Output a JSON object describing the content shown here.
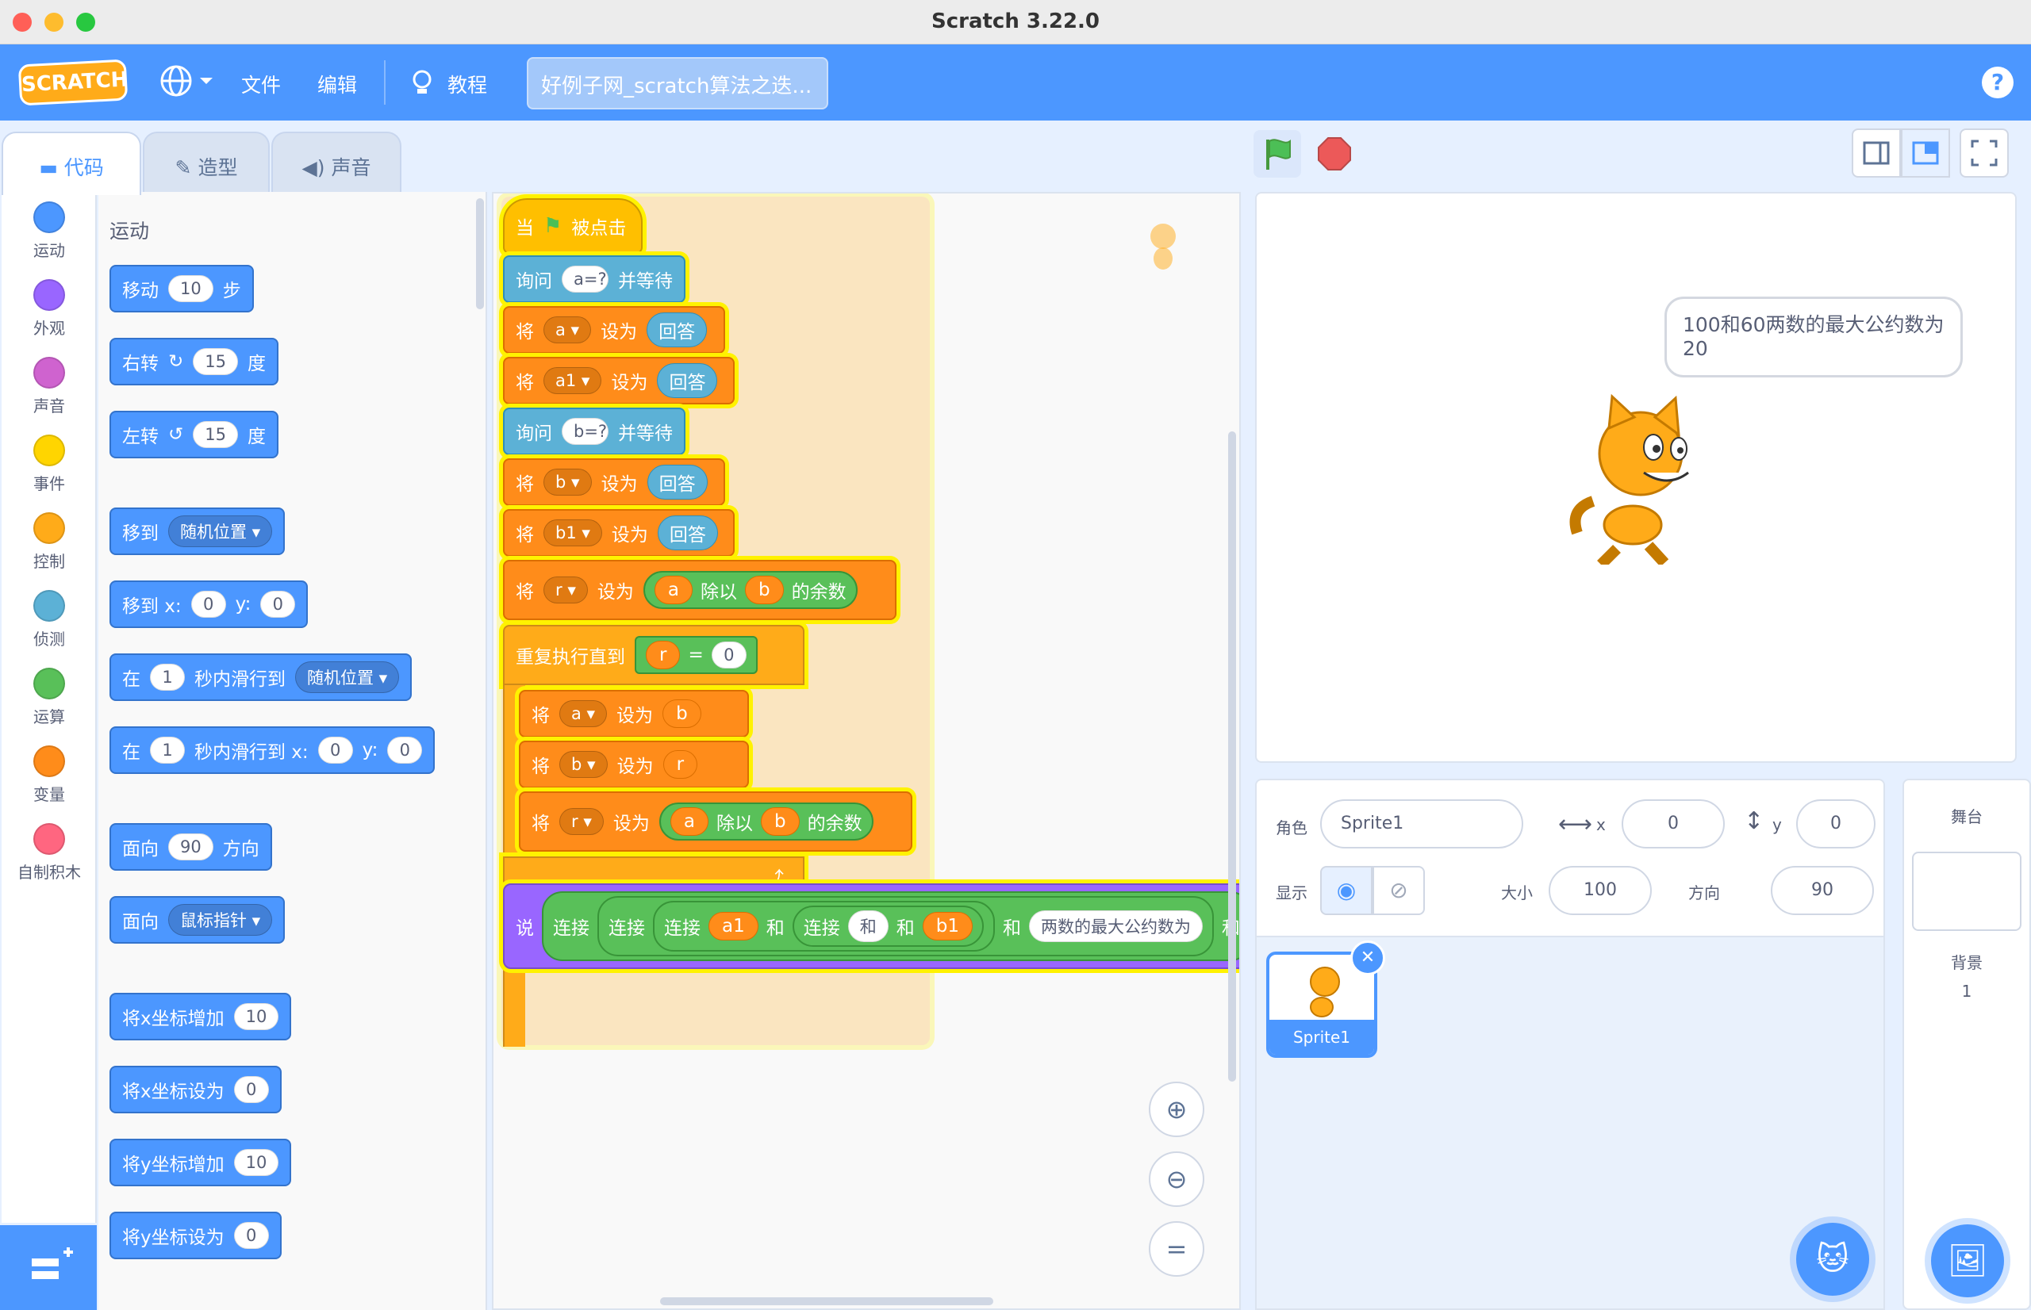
{
  "window": {
    "title": "Scratch 3.22.0"
  },
  "menu": {
    "logo": "SCRATCH",
    "file": "文件",
    "edit": "编辑",
    "tutorials": "教程",
    "project_title": "好例子网_scratch算法之迭...",
    "help": "?"
  },
  "tabs": {
    "code": "代码",
    "costumes": "造型",
    "sounds": "声音"
  },
  "categories": [
    {
      "label": "运动",
      "color": "#4c97ff"
    },
    {
      "label": "外观",
      "color": "#9966ff"
    },
    {
      "label": "声音",
      "color": "#cf63cf"
    },
    {
      "label": "事件",
      "color": "#ffd500"
    },
    {
      "label": "控制",
      "color": "#ffab19"
    },
    {
      "label": "侦测",
      "color": "#5cb1d6"
    },
    {
      "label": "运算",
      "color": "#59c059"
    },
    {
      "label": "变量",
      "color": "#ff8c1a"
    },
    {
      "label": "自制积木",
      "color": "#ff6680"
    }
  ],
  "palette": {
    "heading": "运动",
    "move": {
      "a": "移动",
      "n": "10",
      "b": "步"
    },
    "turn_right": {
      "a": "右转",
      "n": "15",
      "b": "度"
    },
    "turn_left": {
      "a": "左转",
      "n": "15",
      "b": "度"
    },
    "goto": {
      "a": "移到",
      "dd": "随机位置"
    },
    "goto_xy": {
      "a": "移到 x:",
      "x": "0",
      "b": "y:",
      "y": "0"
    },
    "glide": {
      "a": "在",
      "n": "1",
      "b": "秒内滑行到",
      "dd": "随机位置"
    },
    "glide_xy": {
      "a": "在",
      "n": "1",
      "b": "秒内滑行到 x:",
      "x": "0",
      "c": "y:",
      "y": "0"
    },
    "point_dir": {
      "a": "面向",
      "n": "90",
      "b": "方向"
    },
    "point_to": {
      "a": "面向",
      "dd": "鼠标指针"
    },
    "change_x": {
      "a": "将x坐标增加",
      "n": "10"
    },
    "set_x": {
      "a": "将x坐标设为",
      "n": "0"
    },
    "change_y": {
      "a": "将y坐标增加",
      "n": "10"
    },
    "set_y": {
      "a": "将y坐标设为",
      "n": "0"
    }
  },
  "script": {
    "hat": {
      "a": "当",
      "b": "被点击"
    },
    "ask1": {
      "a": "询问",
      "q": "a=?",
      "b": "并等待"
    },
    "set_a": {
      "k": "将",
      "v": "a",
      "s": "设为",
      "r": "回答"
    },
    "set_a1": {
      "k": "将",
      "v": "a1",
      "s": "设为",
      "r": "回答"
    },
    "ask2": {
      "a": "询问",
      "q": "b=?",
      "b": "并等待"
    },
    "set_b": {
      "k": "将",
      "v": "b",
      "s": "设为",
      "r": "回答"
    },
    "set_b1": {
      "k": "将",
      "v": "b1",
      "s": "设为",
      "r": "回答"
    },
    "set_r": {
      "k": "将",
      "v": "r",
      "s": "设为",
      "x": "a",
      "mod": "除以",
      "y": "b",
      "rem": "的余数"
    },
    "repeat": {
      "a": "重复执行直到",
      "l": "r",
      "eq": "=",
      "n": "0"
    },
    "in_a": {
      "k": "将",
      "v": "a",
      "s": "设为",
      "r": "b"
    },
    "in_b": {
      "k": "将",
      "v": "b",
      "s": "设为",
      "r": "r"
    },
    "in_r": {
      "k": "将",
      "v": "r",
      "s": "设为",
      "x": "a",
      "mod": "除以",
      "y": "b",
      "rem": "的余数"
    },
    "say": {
      "a": "说",
      "j1": "连接",
      "j2": "连接",
      "j3": "连接",
      "a1": "a1",
      "and1": "和",
      "j4": "连接",
      "and2": "和",
      "and3": "和",
      "b1": "b1",
      "and4": "和",
      "txt": "两数的最大公约数为",
      "tail": "和"
    }
  },
  "stage": {
    "bubble": "100和60两数的最大公约数为20"
  },
  "sprite_info": {
    "sprite_label": "角色",
    "name": "Sprite1",
    "x_label": "x",
    "x": "0",
    "y_label": "y",
    "y": "0",
    "show_label": "显示",
    "size_label": "大小",
    "size": "100",
    "dir_label": "方向",
    "dir": "90"
  },
  "sprites": [
    {
      "name": "Sprite1"
    }
  ],
  "stage_pane": {
    "title": "舞台",
    "backdrop_label": "背景",
    "backdrop_count": "1"
  }
}
